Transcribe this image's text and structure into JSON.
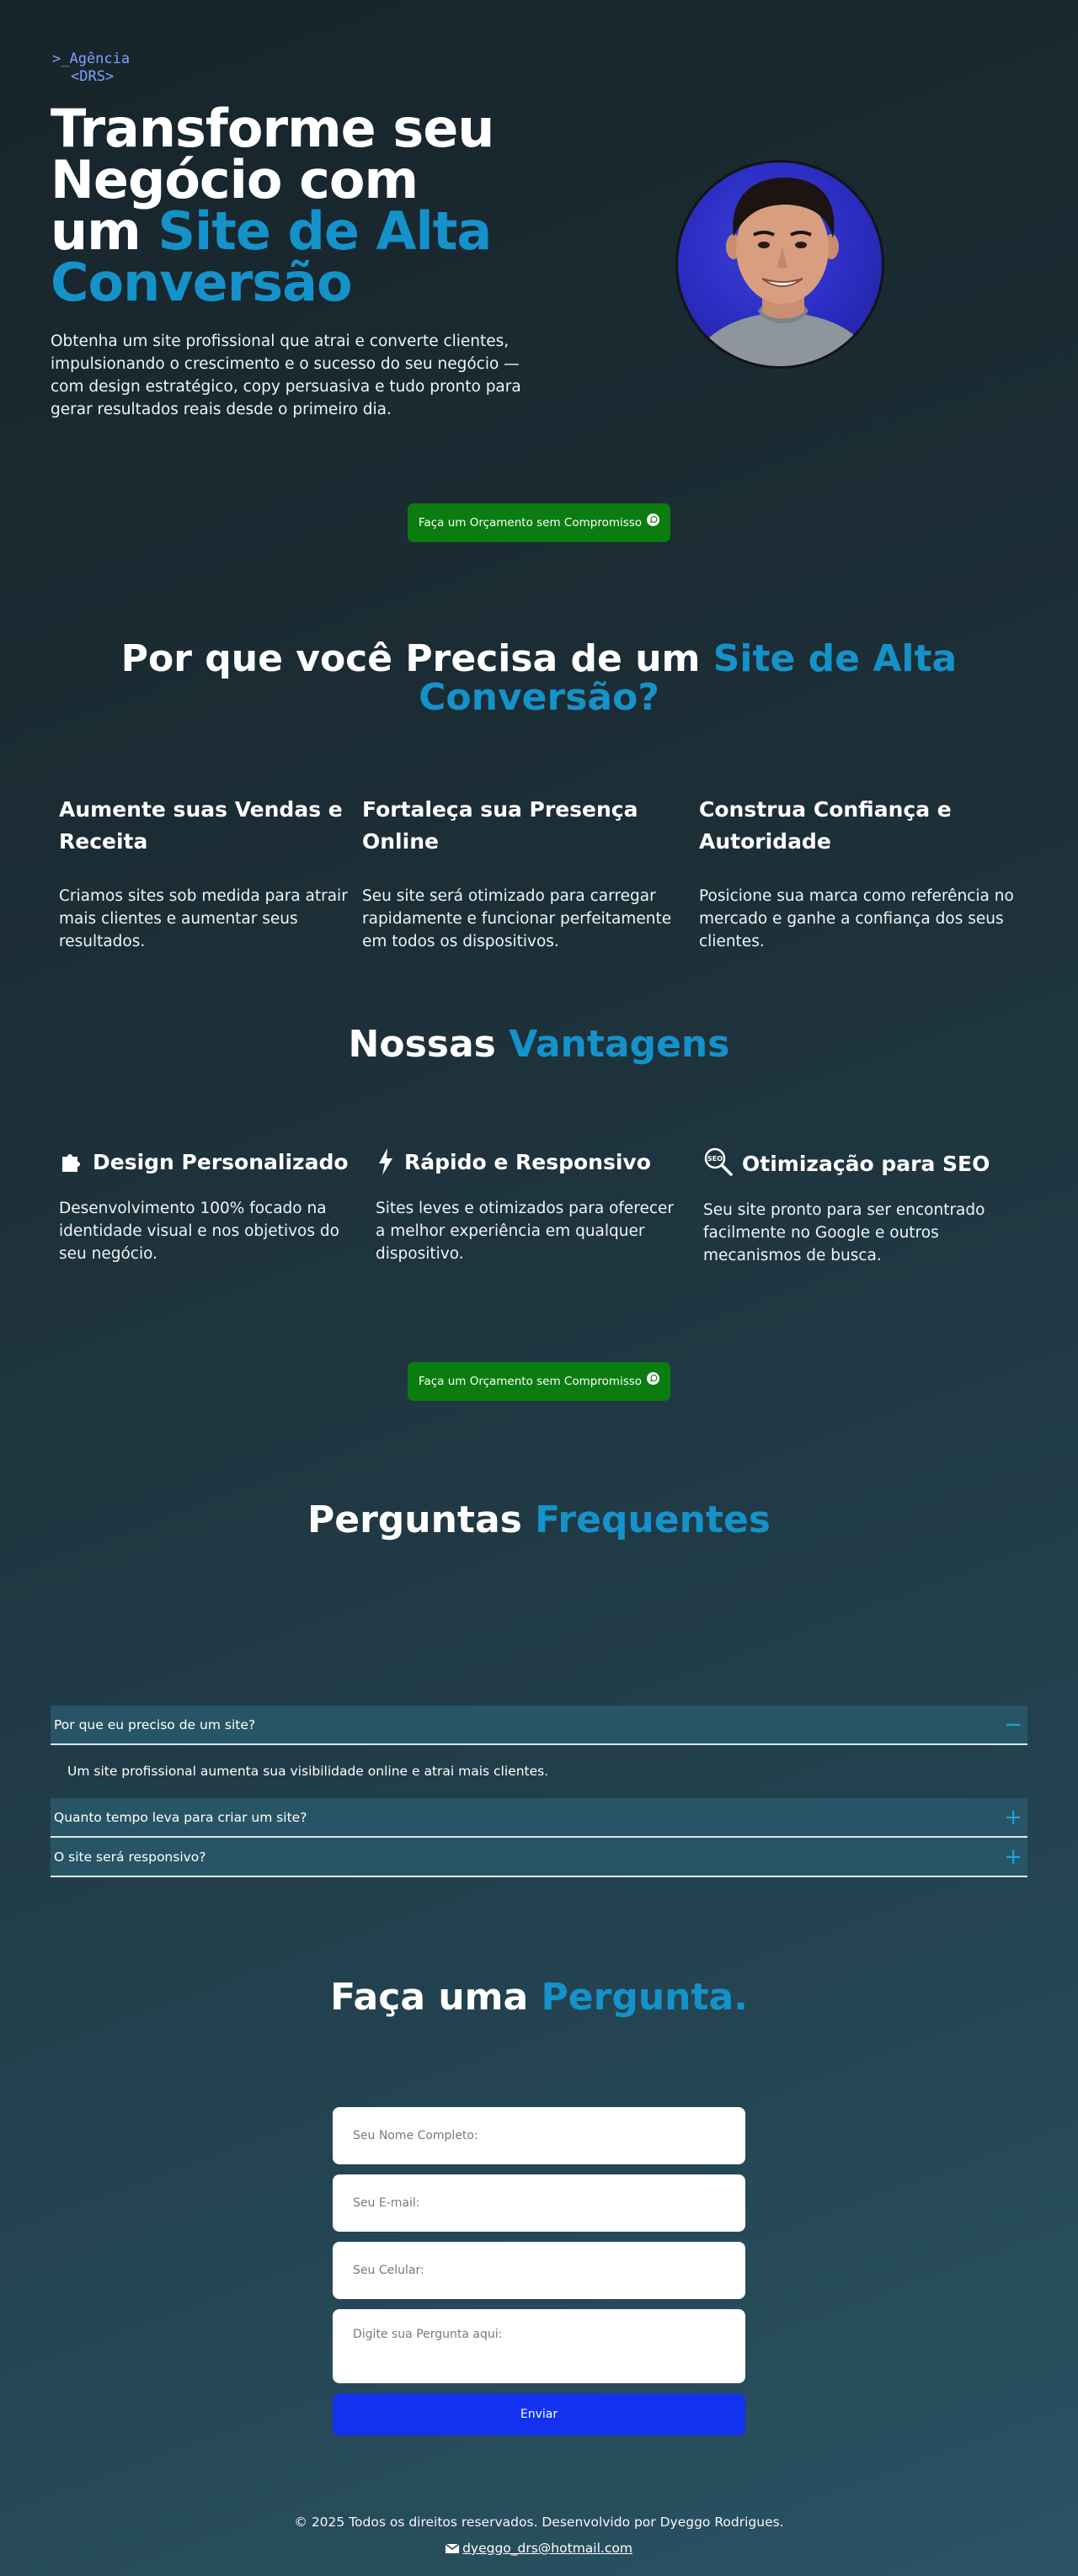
{
  "logo": {
    "line1": ">_Agência",
    "line2": "<DRS>"
  },
  "hero": {
    "title_line1": "Transforme seu",
    "title_line2": "Negócio com",
    "title_line3_plain": "um ",
    "title_line3_accent": "Site de Alta",
    "title_line4_accent": "Conversão",
    "description": "Obtenha um site profissional que atrai e converte clientes, impulsionando o crescimento e o sucesso do seu negócio — com design estratégico, copy persuasiva e tudo pronto para gerar resultados reais desde o primeiro dia."
  },
  "cta": {
    "label": "Faça um Orçamento sem Compromisso",
    "icon": "whatsapp-icon"
  },
  "why": {
    "title_plain": "Por que você Precisa de um ",
    "title_accent_1": "Site de Alta",
    "title_accent_2": "Conversão?",
    "columns": [
      {
        "title": "Aumente suas Vendas e Receita",
        "text": "Criamos sites sob medida para atrair mais clientes e aumentar seus resultados."
      },
      {
        "title": "Fortaleça sua Presença Online",
        "text": "Seu site será otimizado para carregar rapidamente e funcionar perfeitamente em todos os dispositivos."
      },
      {
        "title": "Construa Confiança e Autoridade",
        "text": "Posicione sua marca como referência no mercado e ganhe a confiança dos seus clientes."
      }
    ]
  },
  "advantages": {
    "title_plain": "Nossas ",
    "title_accent": "Vantagens",
    "items": [
      {
        "icon": "puzzle-icon",
        "title": "Design Personalizado",
        "text": "Desenvolvimento 100% focado na identidade visual e nos objetivos do seu negócio."
      },
      {
        "icon": "lightning-icon",
        "title": "Rápido e Responsivo",
        "text": "Sites leves e otimizados para oferecer a melhor experiência em qualquer dispositivo."
      },
      {
        "icon": "seo-search-icon",
        "title": "Otimização para SEO",
        "text": "Seu site pronto para ser encontrado facilmente no Google e outros mecanismos de busca."
      }
    ]
  },
  "faq": {
    "title_plain": "Perguntas ",
    "title_accent": "Frequentes",
    "items": [
      {
        "question": "Por que eu preciso de um site?",
        "answer": "Um site profissional aumenta sua visibilidade online e atrai mais clientes.",
        "sign": "−"
      },
      {
        "question": "Quanto tempo leva para criar um site?",
        "sign": "+"
      },
      {
        "question": "O site será responsivo?",
        "sign": "+"
      }
    ]
  },
  "contact": {
    "title_plain": "Faça uma ",
    "title_accent": "Pergunta.",
    "name_placeholder": "Seu Nome Completo:",
    "email_placeholder": "Seu E-mail:",
    "phone_placeholder": "Seu Celular:",
    "question_placeholder": "Digite sua Pergunta aqui:",
    "submit_label": "Enviar"
  },
  "footer": {
    "copyright": "© 2025 Todos os direitos reservados. Desenvolvido por Dyeggo Rodrigues.",
    "email": "dyeggo_drs@hotmail.com"
  },
  "colors": {
    "accent": "#1592c9",
    "cta": "#0b7d10",
    "submit": "#1232f0",
    "faq_header": "#285565"
  }
}
